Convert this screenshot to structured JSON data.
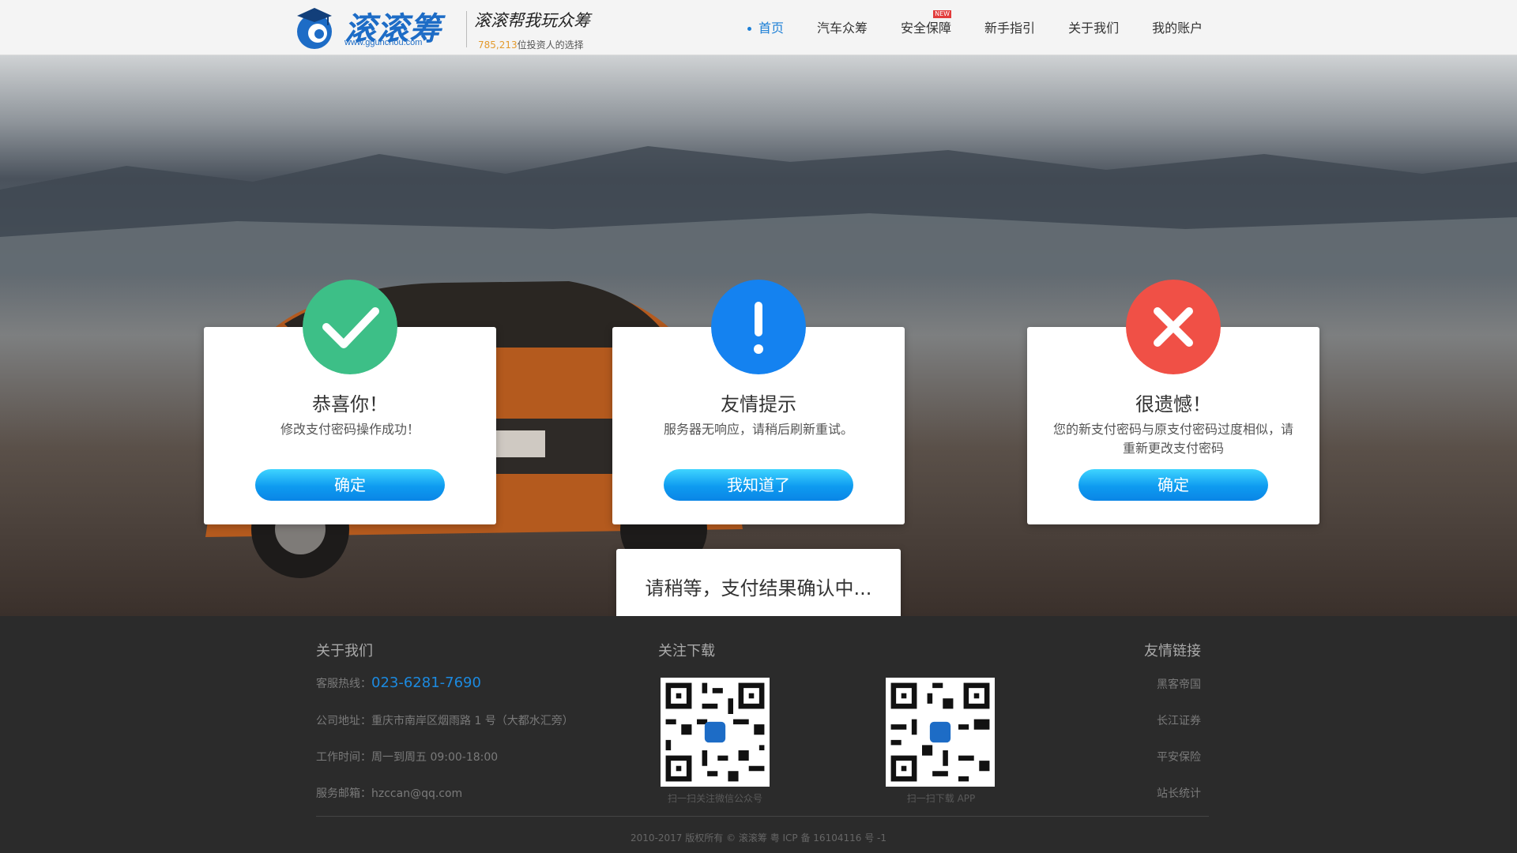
{
  "header": {
    "logo_name": "滚滚筹",
    "logo_url": "www.ggunchou.com",
    "slogan": "滚滚帮我玩众筹",
    "investors_count": "785,213",
    "investors_suffix": "位投资人的选择"
  },
  "nav": {
    "items": [
      {
        "label": "首页"
      },
      {
        "label": "汽车众筹"
      },
      {
        "label": "安全保障",
        "badge": "NEW"
      },
      {
        "label": "新手指引"
      },
      {
        "label": "关于我们"
      },
      {
        "label": "我的账户"
      }
    ]
  },
  "dialogs": [
    {
      "type": "success",
      "title": "恭喜你！",
      "message": "修改支付密码操作成功！",
      "button": "确定",
      "color": "#3dbf87"
    },
    {
      "type": "info",
      "title": "友情提示",
      "message": "服务器无响应，请稍后刷新重试。",
      "button": "我知道了",
      "color": "#1482f0"
    },
    {
      "type": "error",
      "title": "很遗憾！",
      "message": "您的新支付密码与原支付密码过度相似，请重新更改支付密码",
      "button": "确定",
      "color": "#f05046"
    }
  ],
  "loading": {
    "text": "请稍等，支付结果确认中..."
  },
  "footer": {
    "about_title": "关于我们",
    "hotline_label": "客服热线：",
    "hotline": "023-6281-7690",
    "address": "公司地址：重庆市南岸区烟雨路 1 号（大都水汇旁）",
    "hours": "工作时间：周一到周五  09:00-18:00",
    "email": "服务邮箱：hzccan@qq.com",
    "follow_title": "关注下载",
    "qr1_caption": "扫一扫关注微信公众号",
    "qr2_caption": "扫一扫下载 APP",
    "links_title": "友情链接",
    "links": [
      "黑客帝国",
      "长江证券",
      "平安保险",
      "站长统计"
    ],
    "copyright": "2010-2017 版权所有 © 滚滚筹 粤 ICP 备 16104116 号 -1"
  }
}
